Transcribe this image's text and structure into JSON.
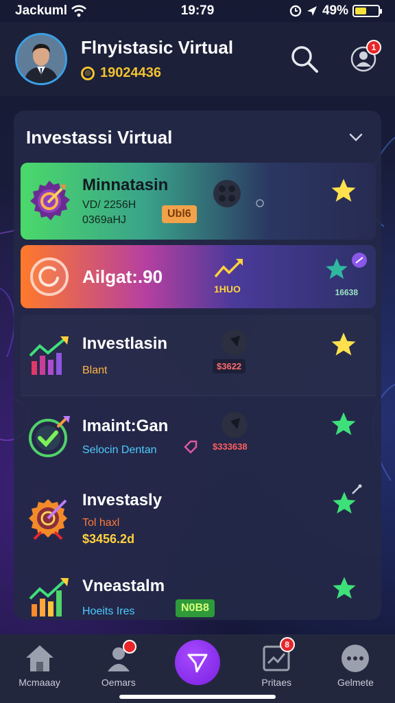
{
  "status": {
    "carrier": "Jackuml",
    "time": "19:79",
    "battery": "49%",
    "battery_level": 0.49,
    "icons": [
      "wifi-icon",
      "location-icon",
      "alarm-icon",
      "battery-icon"
    ]
  },
  "header": {
    "title": "Flnyistasic Virtual",
    "balance": "19024436",
    "notification_badge": "1"
  },
  "panel": {
    "title": "Investassi Virtual",
    "cards": [
      {
        "title": "Minnatasin",
        "line1": "VD/ 2256H",
        "line2": "0369aHJ",
        "tag": "Ubl6",
        "icon": "target-gear-icon"
      },
      {
        "title": "Ailgat:.90",
        "mid": "1HUO",
        "right": "16638",
        "icon": "ring-icon"
      }
    ],
    "rows": [
      {
        "title": "Investlasin",
        "sub": "Blant",
        "mid": "$3622",
        "icon": "growth-chart-icon"
      },
      {
        "title": "Imaint:Gan",
        "sub": "Selocin Dentan",
        "mid": "$333638",
        "icon": "check-badge-icon"
      },
      {
        "title": "Investasly",
        "sub": "Tol haxl",
        "sub2": "$3456.2d",
        "icon": "target-badge-icon"
      },
      {
        "title": "Vneastalm",
        "sub": "Hoeits Ires",
        "tag": "N0B8",
        "icon": "bar-chart-icon"
      }
    ]
  },
  "nav": {
    "items": [
      {
        "label": "Mcmaaay",
        "icon": "home-icon"
      },
      {
        "label": "Oemars",
        "icon": "user-icon",
        "badge": ""
      },
      {
        "label": "",
        "icon": "send-icon"
      },
      {
        "label": "Pritaes",
        "icon": "document-icon",
        "badge": "8"
      },
      {
        "label": "Gelmete",
        "icon": "more-icon"
      }
    ]
  },
  "colors": {
    "accent_green": "#4bd96a",
    "accent_orange": "#ff7a2a",
    "accent_purple": "#8a2be2",
    "star_yellow": "#ffe14d",
    "star_green": "#3ee07a",
    "badge_red": "#e8262a"
  }
}
